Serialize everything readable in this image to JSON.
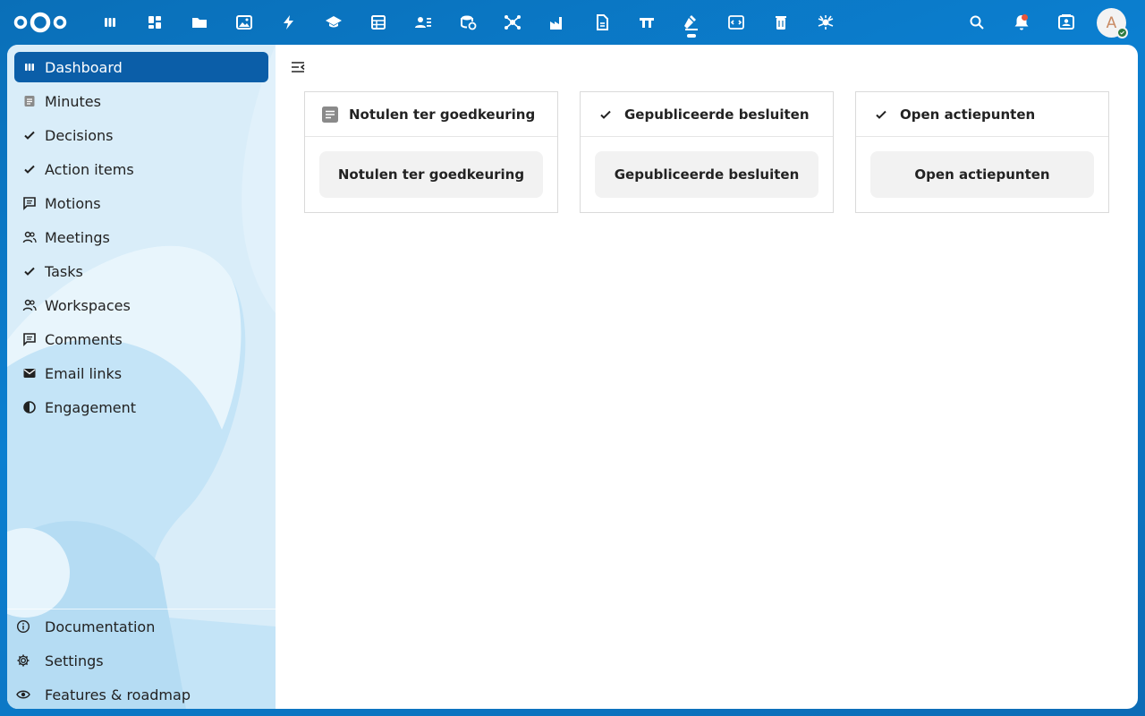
{
  "header": {
    "logo": "nextcloud-logo",
    "apps": [
      {
        "name": "dashboard-icon"
      },
      {
        "name": "apps-grid-icon"
      },
      {
        "name": "files-folder-icon"
      },
      {
        "name": "photos-icon"
      },
      {
        "name": "activity-bolt-icon"
      },
      {
        "name": "learning-cap-icon"
      },
      {
        "name": "tables-icon"
      },
      {
        "name": "contacts-icon"
      },
      {
        "name": "database-icon"
      },
      {
        "name": "network-icon"
      },
      {
        "name": "factory-icon"
      },
      {
        "name": "document-icon"
      },
      {
        "name": "board-icon"
      },
      {
        "name": "gavel-icon"
      },
      {
        "name": "code-window-icon"
      },
      {
        "name": "trash-icon"
      },
      {
        "name": "spider-icon"
      }
    ],
    "right_icons": [
      "search-icon",
      "notifications-icon",
      "contacts-menu-icon"
    ],
    "avatar_initial": "A",
    "status_color": "#2d7b41"
  },
  "sidebar": {
    "items": [
      {
        "label": "Dashboard",
        "icon": "dashboard-icon",
        "active": true
      },
      {
        "label": "Minutes",
        "icon": "document-icon"
      },
      {
        "label": "Decisions",
        "icon": "check-icon"
      },
      {
        "label": "Action items",
        "icon": "check-icon"
      },
      {
        "label": "Motions",
        "icon": "comment-icon"
      },
      {
        "label": "Meetings",
        "icon": "people-icon"
      },
      {
        "label": "Tasks",
        "icon": "check-icon"
      },
      {
        "label": "Workspaces",
        "icon": "people-icon"
      },
      {
        "label": "Comments",
        "icon": "comment-icon"
      },
      {
        "label": "Email links",
        "icon": "email-icon"
      },
      {
        "label": "Engagement",
        "icon": "half-circle-icon"
      }
    ],
    "bottom": [
      {
        "label": "Documentation",
        "icon": "info-icon"
      },
      {
        "label": "Settings",
        "icon": "gear-icon"
      },
      {
        "label": "Features & roadmap",
        "icon": "eye-icon"
      }
    ]
  },
  "main": {
    "cards": [
      {
        "title": "Notulen ter goedkeuring",
        "icon": "document-icon",
        "button": "Notulen ter goedkeuring"
      },
      {
        "title": "Gepubliceerde besluiten",
        "icon": "check-icon",
        "button": "Gepubliceerde besluiten"
      },
      {
        "title": "Open actiepunten",
        "icon": "check-icon",
        "button": "Open actiepunten"
      }
    ]
  },
  "colors": {
    "primary": "#0b5ea8",
    "header_bg": "#0a6fb8"
  }
}
